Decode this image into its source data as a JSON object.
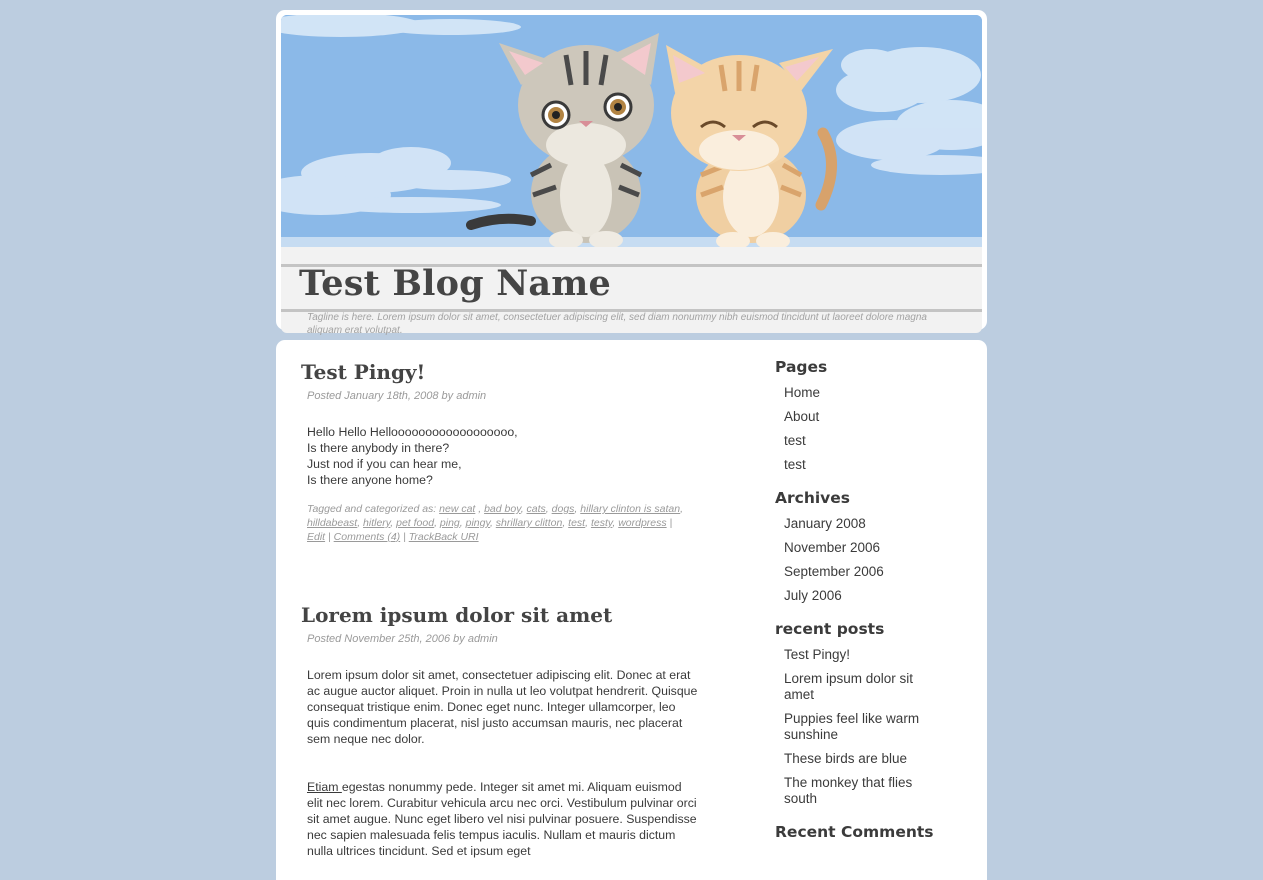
{
  "header": {
    "blog_title": "Test Blog Name",
    "tagline": "Tagline is here. Lorem ipsum dolor sit amet, consectetuer adipiscing elit, sed diam nonummy nibh euismod tincidunt ut laoreet dolore magna aliquam erat volutpat."
  },
  "posts": [
    {
      "title": "Test Pingy!",
      "meta": "Posted January 18th, 2008 by admin",
      "body": [
        "Hello Hello Helloooooooooooooooooo,",
        "Is there anybody in there?",
        "Just nod if you can hear me,",
        "Is there anyone home?"
      ],
      "tags_prefix": "Tagged and categorized as:",
      "tags": [
        "new cat",
        "bad boy",
        "cats",
        "dogs",
        "hillary clinton is satan",
        "hilldabeast",
        "hitlery",
        "pet food",
        "ping",
        "pingy",
        "shrillary clitton",
        "test",
        "testy",
        "wordpress"
      ],
      "edit_label": "Edit",
      "comments_label": "Comments (4)",
      "trackback_label": "TrackBack URI"
    },
    {
      "title": "Lorem ipsum dolor sit amet",
      "meta": "Posted November 25th, 2006 by admin",
      "para1": "Lorem ipsum dolor sit amet, consectetuer adipiscing elit. Donec at erat ac augue auctor aliquet. Proin in nulla ut leo volutpat hendrerit. Quisque consequat tristique enim. Donec eget nunc. Integer ullamcorper, leo quis condimentum placerat, nisl justo accumsan mauris, nec placerat sem neque nec dolor.",
      "para2_link": "Etiam ",
      "para2": "egestas nonummy pede. Integer sit amet mi. Aliquam euismod elit nec lorem. Curabitur vehicula arcu nec orci. Vestibulum pulvinar orci sit amet augue. Nunc eget libero vel nisi pulvinar posuere. Suspendisse nec sapien malesuada felis tempus iaculis. Nullam et mauris dictum nulla ultrices tincidunt. Sed et ipsum eget"
    }
  ],
  "sidebar": {
    "pages": {
      "heading": "Pages",
      "items": [
        "Home",
        "About",
        "test",
        "test"
      ]
    },
    "archives": {
      "heading": "Archives",
      "items": [
        "January 2008",
        "November 2006",
        "September 2006",
        "July 2006"
      ]
    },
    "recent_posts": {
      "heading": "recent posts",
      "items": [
        "Test Pingy!",
        "Lorem ipsum dolor sit amet",
        "Puppies feel like warm sunshine",
        "These birds are blue",
        "The monkey that flies south"
      ]
    },
    "recent_comments": {
      "heading": "Recent Comments"
    }
  },
  "colors": {
    "background": "#bccde0",
    "sky": "#8bb9e8",
    "title_text": "#454545"
  }
}
